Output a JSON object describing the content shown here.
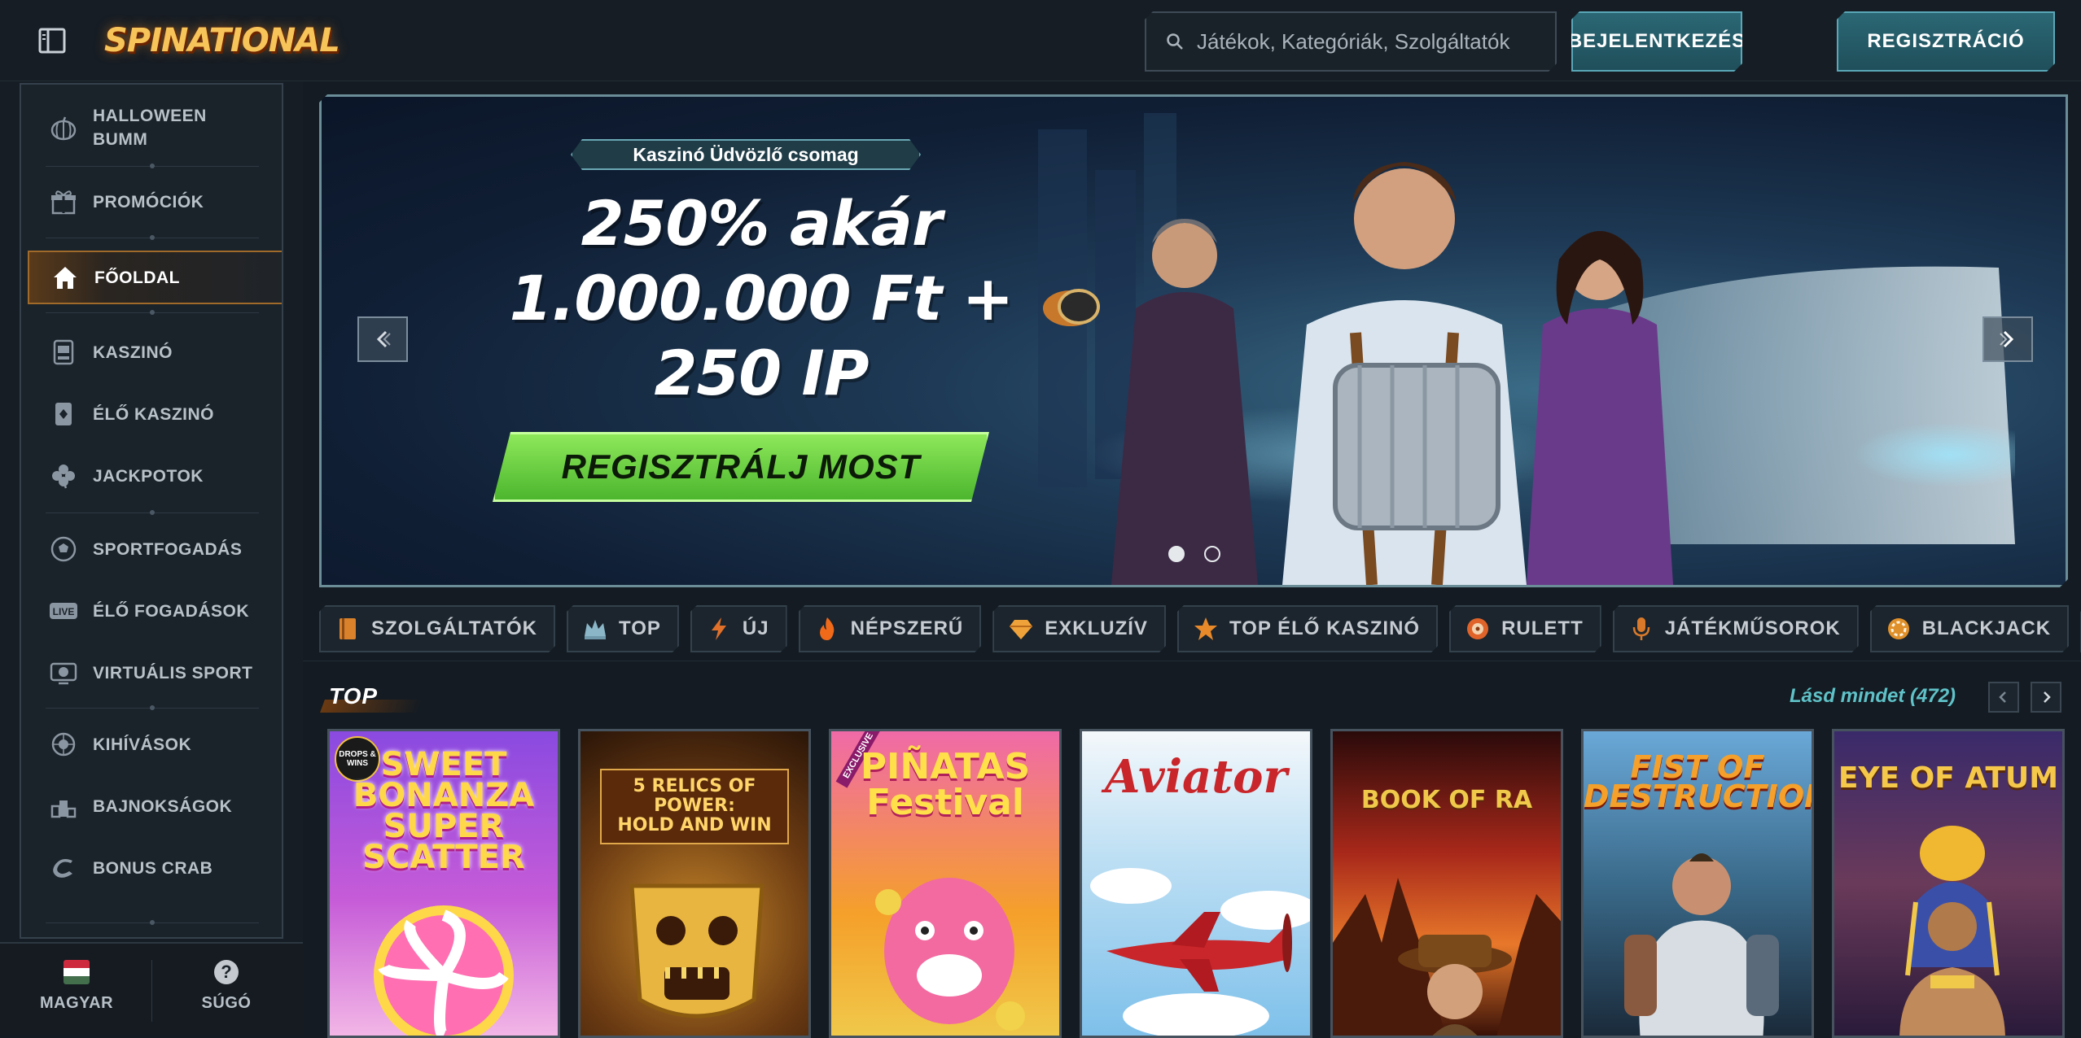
{
  "header": {
    "logo_text": "SPINATIONAL",
    "search_placeholder": "Játékok, Kategóriák, Szolgáltatók",
    "login_label": "BEJELENTKEZÉS",
    "register_label": "REGISZTRÁCIÓ"
  },
  "sidebar": {
    "items": [
      {
        "label": "HALLOWEEN BUMM",
        "icon": "pumpkin-icon"
      },
      {
        "label": "PROMÓCIÓK",
        "icon": "gift-icon"
      },
      {
        "label": "FŐOLDAL",
        "icon": "home-icon",
        "active": true
      },
      {
        "label": "KASZINÓ",
        "icon": "slot-machine-icon"
      },
      {
        "label": "ÉLŐ KASZINÓ",
        "icon": "cards-icon"
      },
      {
        "label": "JACKPOTOK",
        "icon": "clover-icon"
      },
      {
        "label": "SPORTFOGADÁS",
        "icon": "soccer-ball-icon"
      },
      {
        "label": "ÉLŐ FOGADÁSOK",
        "icon": "live-icon"
      },
      {
        "label": "VIRTUÁLIS SPORT",
        "icon": "virtual-sport-icon"
      },
      {
        "label": "KIHÍVÁSOK",
        "icon": "challenge-icon"
      },
      {
        "label": "BAJNOKSÁGOK",
        "icon": "podium-icon"
      },
      {
        "label": "BONUS CRAB",
        "icon": "claw-icon"
      }
    ],
    "language_label": "MAGYAR",
    "help_label": "SÚGÓ",
    "help_glyph": "?"
  },
  "banner": {
    "pill_text": "Kaszinó Üdvözlő csomag",
    "line1": "250% akár",
    "line2": "1.000.000 Ft +",
    "line3": "250 IP",
    "cta_label": "REGISZTRÁLJ MOST",
    "slides": 2,
    "active_slide": 1
  },
  "categories": [
    {
      "label": "SZOLGÁLTATÓK",
      "icon": "book-icon",
      "color": "#d9822b"
    },
    {
      "label": "TOP",
      "icon": "crown-icon",
      "color": "#8ab6c8"
    },
    {
      "label": "ÚJ",
      "icon": "lightning-icon",
      "color": "#e0702a"
    },
    {
      "label": "NÉPSZERŰ",
      "icon": "fire-icon",
      "color": "#f06a1a"
    },
    {
      "label": "EXKLUZÍV",
      "icon": "diamond-icon",
      "color": "#f0a23a"
    },
    {
      "label": "TOP ÉLŐ KASZINÓ",
      "icon": "star-icon",
      "color": "#e8892a"
    },
    {
      "label": "RULETT",
      "icon": "roulette-icon",
      "color": "#e0642a"
    },
    {
      "label": "JÁTÉKMŰSOROK",
      "icon": "microphone-icon",
      "color": "#d97a2b"
    },
    {
      "label": "BLACKJACK",
      "icon": "chip-icon",
      "color": "#e0902a"
    }
  ],
  "top_section": {
    "title": "TOP",
    "see_all": "Lásd mindet (472)"
  },
  "games": [
    {
      "name": "Sweet Bonanza Super Scatter",
      "title": "SWEET\nBONANZA\nSUPER\nSCATTER",
      "badge": "DROPS & WINS",
      "bg": "#7a3fd0"
    },
    {
      "name": "5 Relics of Power: Hold and Win",
      "title": "5 RELICS OF POWER:\nHOLD AND WIN",
      "bg": "#5a2a10"
    },
    {
      "name": "Piñatas Festival",
      "title": "PIÑATAS\nFestival",
      "badge": "EXCLUSIVE",
      "bg": "#e04a8a"
    },
    {
      "name": "Aviator",
      "title": "Aviator",
      "bg": "#cfe6f5"
    },
    {
      "name": "Book of Ra",
      "title": "BOOK OF RA",
      "bg": "#6a1a10"
    },
    {
      "name": "Fist of Destruction",
      "title": "FIST OF\nDESTRUCTION",
      "bg": "#3a6a8a"
    },
    {
      "name": "Eye of Atum",
      "title": "EYE OF ATUM",
      "bg": "#2a2a5a"
    }
  ]
}
